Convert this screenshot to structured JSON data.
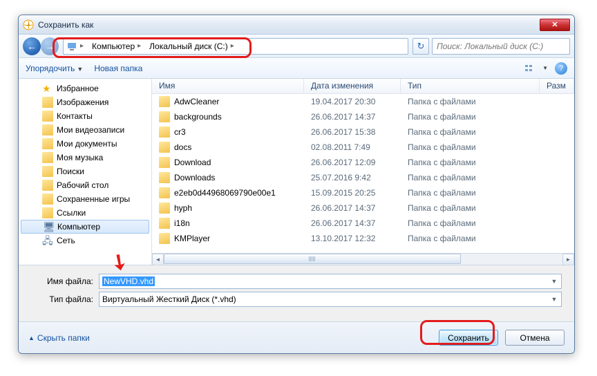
{
  "window": {
    "title": "Сохранить как"
  },
  "nav": {
    "crumbs": [
      "Компьютер",
      "Локальный диск (C:)"
    ],
    "search_placeholder": "Поиск: Локальный диск (C:)"
  },
  "toolbar": {
    "organize": "Упорядочить",
    "new_folder": "Новая папка"
  },
  "tree": [
    {
      "label": "Избранное",
      "icon": "star"
    },
    {
      "label": "Изображения",
      "icon": "folder"
    },
    {
      "label": "Контакты",
      "icon": "folder"
    },
    {
      "label": "Мои видеозаписи",
      "icon": "folder"
    },
    {
      "label": "Мои документы",
      "icon": "folder"
    },
    {
      "label": "Моя музыка",
      "icon": "folder"
    },
    {
      "label": "Поиски",
      "icon": "folder"
    },
    {
      "label": "Рабочий стол",
      "icon": "folder"
    },
    {
      "label": "Сохраненные игры",
      "icon": "folder"
    },
    {
      "label": "Ссылки",
      "icon": "folder"
    },
    {
      "label": "Компьютер",
      "icon": "computer",
      "selected": true
    },
    {
      "label": "Сеть",
      "icon": "network"
    }
  ],
  "list": {
    "headers": {
      "name": "Имя",
      "date": "Дата изменения",
      "type": "Тип",
      "size": "Разм"
    },
    "rows": [
      {
        "name": "AdwCleaner",
        "date": "19.04.2017 20:30",
        "type": "Папка с файлами"
      },
      {
        "name": "backgrounds",
        "date": "26.06.2017 14:37",
        "type": "Папка с файлами"
      },
      {
        "name": "cr3",
        "date": "26.06.2017 15:38",
        "type": "Папка с файлами"
      },
      {
        "name": "docs",
        "date": "02.08.2011 7:49",
        "type": "Папка с файлами"
      },
      {
        "name": "Download",
        "date": "26.06.2017 12:09",
        "type": "Папка с файлами"
      },
      {
        "name": "Downloads",
        "date": "25.07.2016 9:42",
        "type": "Папка с файлами"
      },
      {
        "name": "e2eb0d44968069790e00e1",
        "date": "15.09.2015 20:25",
        "type": "Папка с файлами"
      },
      {
        "name": "hyph",
        "date": "26.06.2017 14:37",
        "type": "Папка с файлами"
      },
      {
        "name": "i18n",
        "date": "26.06.2017 14:37",
        "type": "Папка с файлами"
      },
      {
        "name": "KMPlayer",
        "date": "13.10.2017 12:32",
        "type": "Папка с файлами"
      }
    ]
  },
  "fields": {
    "filename_label": "Имя файла:",
    "filename_value": "NewVHD.vhd",
    "filetype_label": "Тип файла:",
    "filetype_value": "Виртуальный Жесткий Диск (*.vhd)"
  },
  "footer": {
    "hide_folders": "Скрыть папки",
    "save": "Сохранить",
    "cancel": "Отмена"
  }
}
